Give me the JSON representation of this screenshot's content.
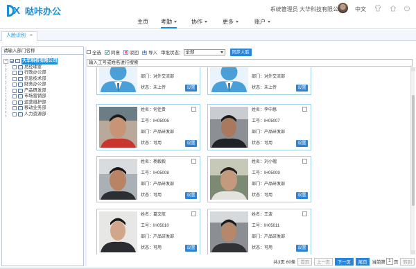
{
  "brand": {
    "name": "哒咔办公",
    "color": "#1a8fd8"
  },
  "header": {
    "user": "系统管理员 大华科技有限公司",
    "lang": "中文",
    "icons": [
      "avatar",
      "shirt-icon",
      "home-icon",
      "power-icon"
    ]
  },
  "nav": {
    "items": [
      {
        "label": "主页",
        "caret": false,
        "active": false
      },
      {
        "label": "考勤",
        "caret": true,
        "active": true
      },
      {
        "label": "协作",
        "caret": true,
        "active": false
      },
      {
        "label": "更多",
        "caret": true,
        "active": false
      },
      {
        "label": "账户",
        "caret": true,
        "active": false
      }
    ]
  },
  "tabs": [
    {
      "label": "人脸识别",
      "close": "×"
    }
  ],
  "left": {
    "placeholder": "请输入部门名称",
    "root": "大华科技有限公司",
    "departments": [
      "总经理室",
      "行政办公部",
      "信息技术部",
      "财务办公部",
      "产品研发部",
      "市场营销部",
      "运营维护部",
      "移动业务部",
      "人力资源部"
    ]
  },
  "toolbar": {
    "select_all": "全选",
    "approve": "同意",
    "reject": "驳回",
    "import": "导入",
    "audit_status_label": "审批状态：",
    "audit_status_value": "全部",
    "sync_button": "同步人脸"
  },
  "search": {
    "placeholder": "输入工号或姓名进行搜索"
  },
  "cards": [
    {
      "name": "",
      "id": "",
      "dept": "部门：对外交流部",
      "status": "状态：未上传",
      "photo": "placeholder",
      "set": "设置"
    },
    {
      "name": "",
      "id": "",
      "dept": "部门：对外交流部",
      "status": "状态：未上传",
      "photo": "placeholder",
      "set": "设置"
    },
    {
      "name": "姓名：何佳贵",
      "id": "工号：IH05006",
      "dept": "部门：产品研发部",
      "status": "状态：可用",
      "photo": "face",
      "set": "设置"
    },
    {
      "name": "姓名：李中慈",
      "id": "工号：IH05007",
      "dept": "部门：产品研发部",
      "status": "状态：可用",
      "photo": "face",
      "set": "设置"
    },
    {
      "name": "姓名：杨毅毅",
      "id": "工号：IH05008",
      "dept": "部门：产品研发部",
      "status": "状态：可用",
      "photo": "face",
      "set": "设置"
    },
    {
      "name": "姓名：刘小帽",
      "id": "工号：IH05009",
      "dept": "部门：产品研发部",
      "status": "状态：可用",
      "photo": "face",
      "set": "设置"
    },
    {
      "name": "姓名：葛文航",
      "id": "工号：IH05010",
      "dept": "部门：产品研发部",
      "status": "状态：可用",
      "photo": "face",
      "set": "设置"
    },
    {
      "name": "姓名：王波",
      "id": "工号：IH05011",
      "dept": "部门：产品研发部",
      "status": "状态：可用",
      "photo": "face",
      "set": "设置"
    }
  ],
  "pager": {
    "summary": "共3页 60条",
    "first": "首页",
    "prev": "上一页",
    "next": "下一页",
    "last": "尾页",
    "current_prefix": "当前第",
    "current_value": "1",
    "current_suffix": "页",
    "go": "转到"
  }
}
